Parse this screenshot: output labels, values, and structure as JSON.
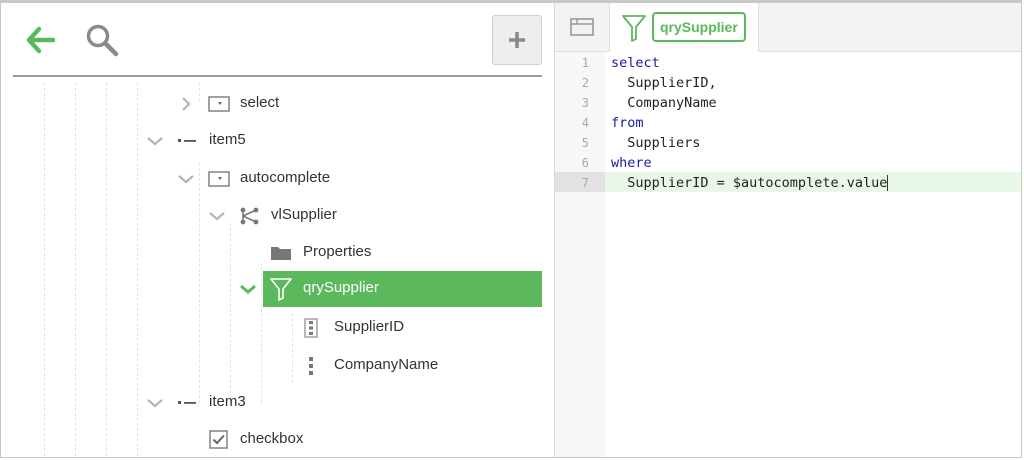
{
  "toolbar": {
    "back": "back-arrow-icon",
    "search": "search-icon",
    "add": "plus-icon"
  },
  "tree": [
    {
      "label": "select",
      "icon": "dropdown-box-icon",
      "expander": "collapsed"
    },
    {
      "label": "item5",
      "icon": "item-dash-icon",
      "expander": "expanded"
    },
    {
      "label": "autocomplete",
      "icon": "dropdown-box-icon",
      "expander": "expanded"
    },
    {
      "label": "vlSupplier",
      "icon": "value-list-graph-icon",
      "expander": "expanded"
    },
    {
      "label": "Properties",
      "icon": "folder-icon",
      "expander": "none"
    },
    {
      "label": "qrySupplier",
      "icon": "funnel-icon",
      "expander": "expanded",
      "selected": true
    },
    {
      "label": "SupplierID",
      "icon": "key-column-icon",
      "expander": "none"
    },
    {
      "label": "CompanyName",
      "icon": "column-icon",
      "expander": "none"
    },
    {
      "label": "item3",
      "icon": "item-dash-icon",
      "expander": "expanded"
    },
    {
      "label": "checkbox",
      "icon": "checkbox-icon",
      "expander": "none"
    }
  ],
  "editor": {
    "tab_label": "qrySupplier",
    "tab_icon": "funnel-icon",
    "file_icon": "window-icon",
    "lines": [
      {
        "num": "1",
        "text": "select"
      },
      {
        "num": "2",
        "text": "  SupplierID,"
      },
      {
        "num": "3",
        "text": "  CompanyName"
      },
      {
        "num": "4",
        "text": "from"
      },
      {
        "num": "5",
        "text": "  Suppliers"
      },
      {
        "num": "6",
        "text": "where"
      },
      {
        "num": "7",
        "text": "  SupplierID = $autocomplete.value"
      }
    ]
  },
  "colors": {
    "accent": "#5cb85c",
    "keyword": "#1a1aa6"
  }
}
